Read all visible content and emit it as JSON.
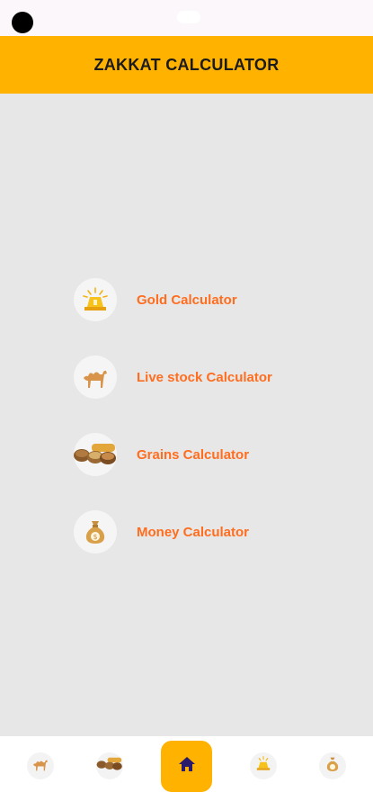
{
  "header": {
    "title": "ZAKKAT CALCULATOR"
  },
  "menu": {
    "items": [
      {
        "label": "Gold Calculator",
        "icon": "gold-bars-icon"
      },
      {
        "label": "Live stock Calculator",
        "icon": "camel-icon"
      },
      {
        "label": "Grains Calculator",
        "icon": "grains-icon"
      },
      {
        "label": "Money Calculator",
        "icon": "money-bag-icon"
      }
    ]
  },
  "bottom_nav": {
    "items": [
      "camel-icon",
      "grains-icon",
      "home-icon",
      "gold-bars-icon",
      "money-bag-icon"
    ],
    "active": "home-icon"
  },
  "colors": {
    "header": "#ffb300",
    "label": "#ff6d1f",
    "background": "#e7e7e7",
    "home_icon": "#2a1a6b"
  }
}
